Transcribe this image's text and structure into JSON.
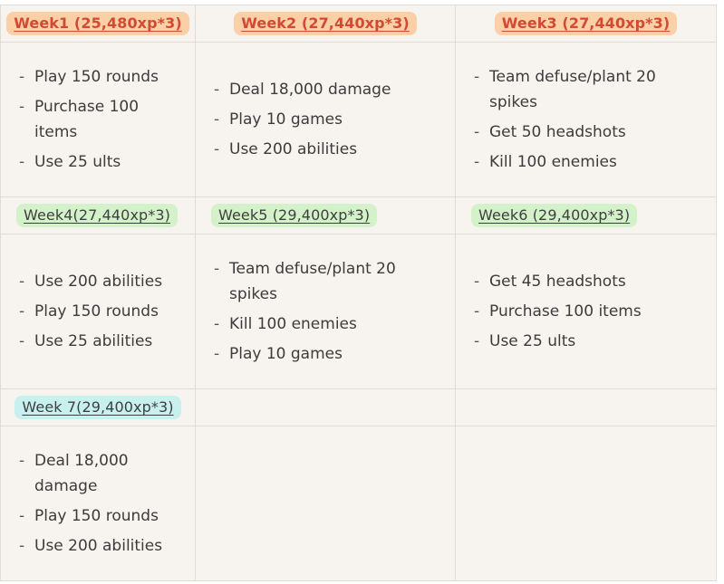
{
  "weeks": [
    {
      "title": "Week1 (25,480xp*3)",
      "color": "#fbd0a6",
      "tasks": [
        "Play 150 rounds",
        "Purchase 100 items",
        "Use 25 ults"
      ]
    },
    {
      "title": "Week2 (27,440xp*3)",
      "color": "#fbd0a6",
      "tasks": [
        "Deal 18,000 damage",
        "Play 10 games",
        "Use 200 abilities"
      ]
    },
    {
      "title": "Week3 (27,440xp*3)",
      "color": "#fbd0a6",
      "tasks": [
        "Team defuse/plant 20 spikes",
        "Get 50 headshots",
        "Kill 100 enemies"
      ]
    },
    {
      "title": "Week4(27,440xp*3)",
      "color": "#d4f2c9",
      "tasks": [
        "Use 200 abilities",
        "Play 150 rounds",
        "Use 25 abilities"
      ]
    },
    {
      "title": "Week5 (29,400xp*3)",
      "color": "#d4f2c9",
      "tasks": [
        "Team defuse/plant 20 spikes",
        "Kill 100 enemies",
        "Play 10 games"
      ]
    },
    {
      "title": "Week6 (29,400xp*3)",
      "color": "#d4f2c9",
      "tasks": [
        "Get 45 headshots",
        "Purchase 100 items",
        "Use 25 ults"
      ]
    },
    {
      "title": "Week 7(29,400xp*3)",
      "color": "#c8f0ee",
      "tasks": [
        "Deal 18,000 damage",
        "Play 150 rounds",
        "Use 200 abilities"
      ]
    }
  ],
  "list_marker": "-"
}
